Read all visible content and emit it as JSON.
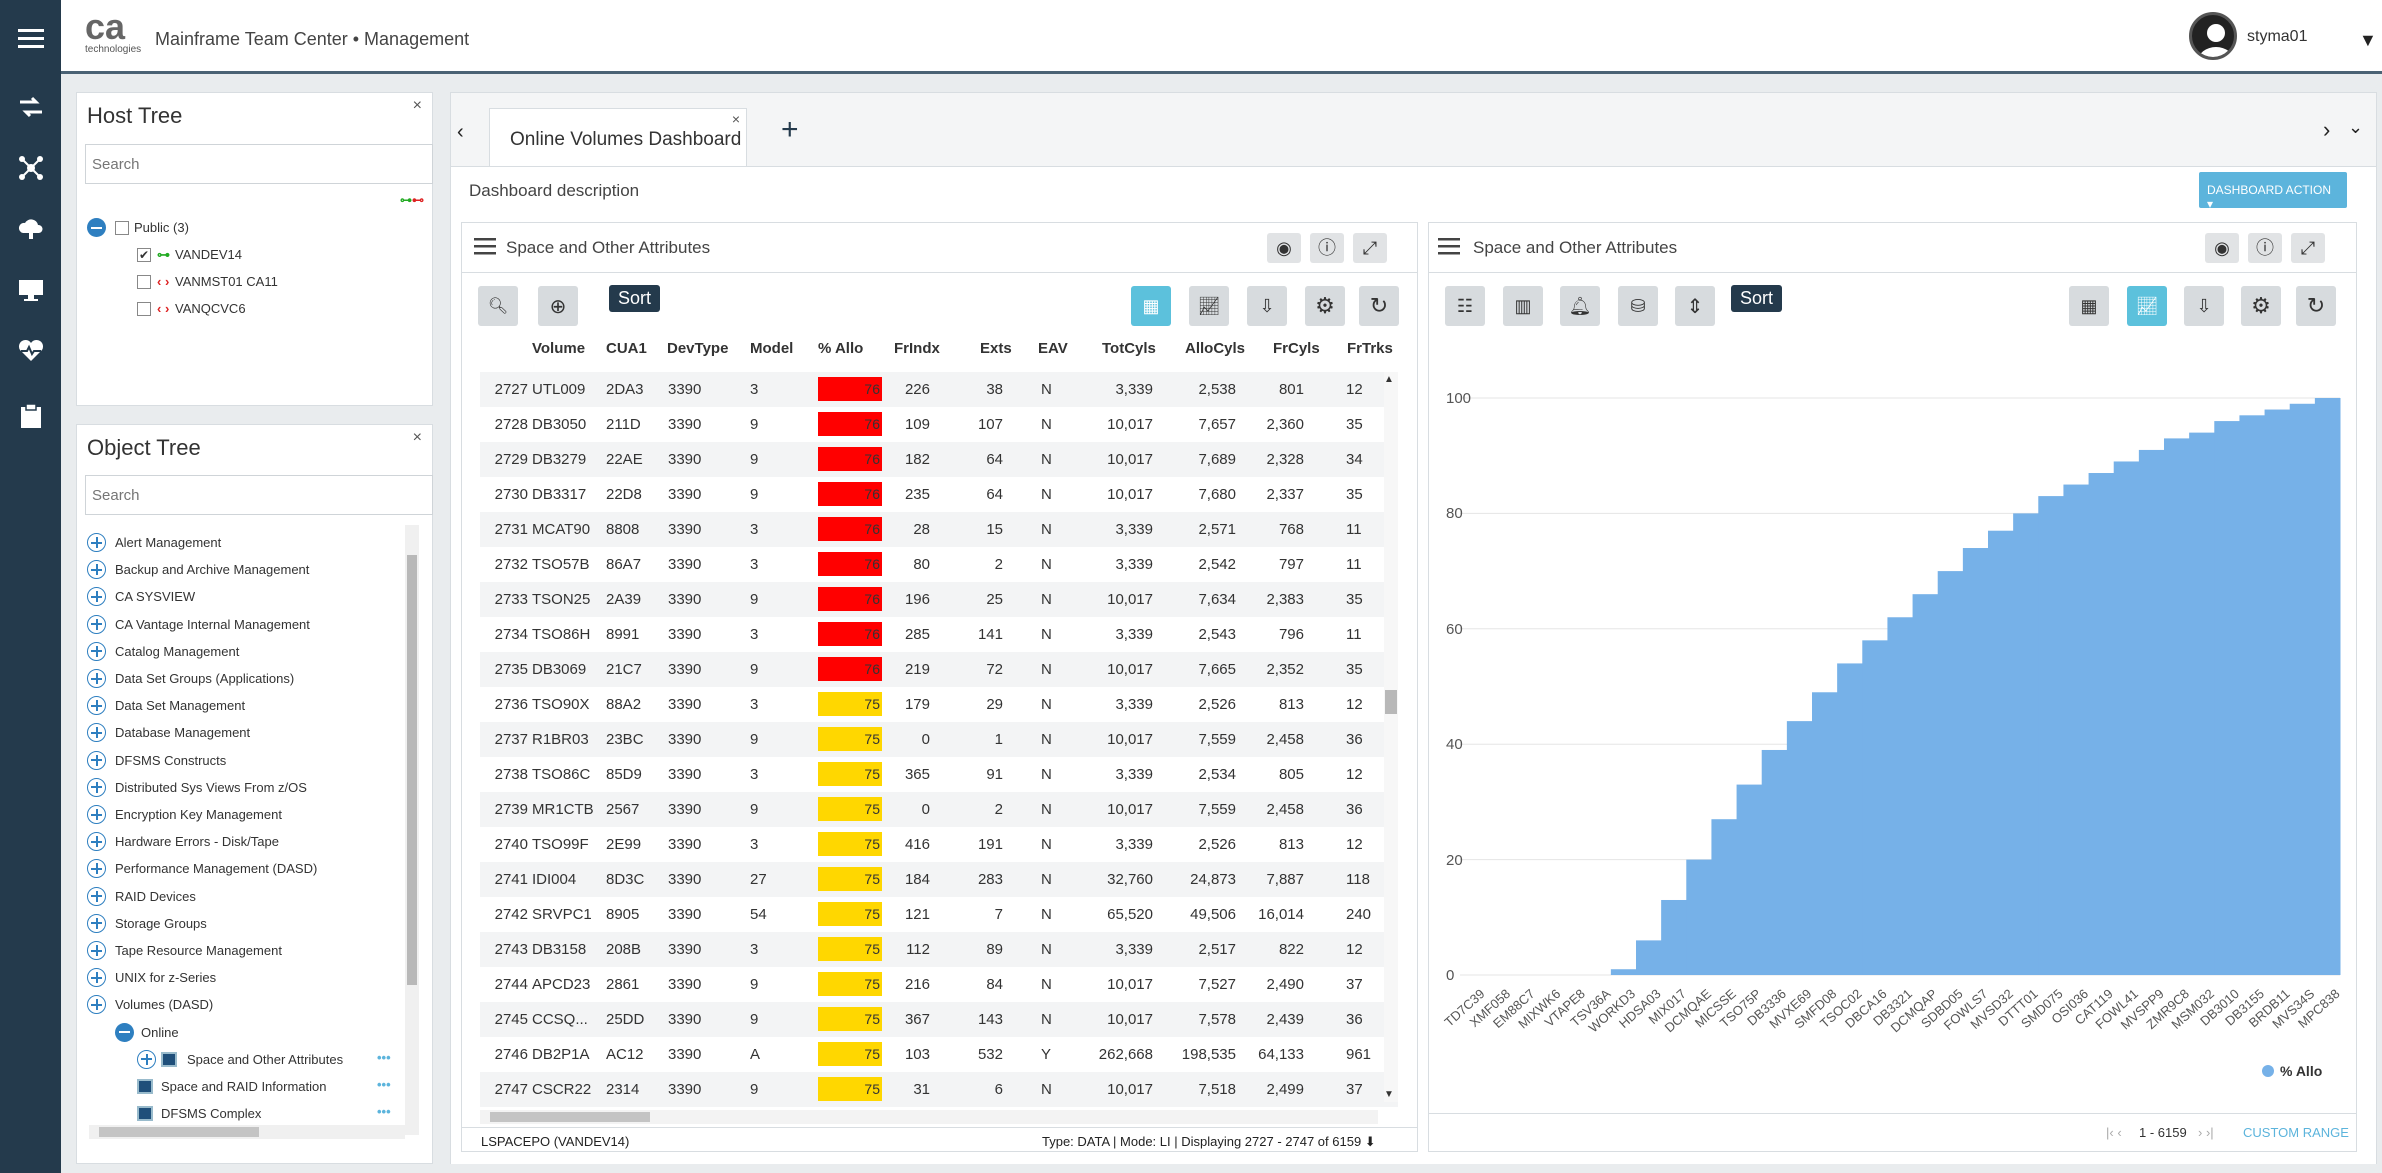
{
  "header": {
    "logo_text": "ca",
    "logo_sub": "technologies",
    "app_title": "Mainframe Team Center • Management",
    "username": "styma01"
  },
  "host_tree": {
    "title": "Host Tree",
    "search_placeholder": "Search",
    "close": "×",
    "root": "Public (3)",
    "items": [
      {
        "label": "VANDEV14",
        "checked": true,
        "status": "connected"
      },
      {
        "label": "VANMST01 CA11",
        "checked": false,
        "status": "disconnected"
      },
      {
        "label": "VANQCVC6",
        "checked": false,
        "status": "disconnected"
      }
    ]
  },
  "object_tree": {
    "title": "Object Tree",
    "search_placeholder": "Search",
    "close": "×",
    "items": [
      "Alert Management",
      "Backup and Archive Management",
      "CA SYSVIEW",
      "CA Vantage Internal Management",
      "Catalog Management",
      "Data Set Groups (Applications)",
      "Data Set Management",
      "Database Management",
      "DFSMS Constructs",
      "Distributed Sys Views From z/OS",
      "Encryption Key Management",
      "Hardware Errors - Disk/Tape",
      "Performance Management (DASD)",
      "RAID Devices",
      "Storage Groups",
      "Tape Resource Management",
      "UNIX for z-Series",
      "Volumes (DASD)"
    ],
    "online": "Online",
    "sub_items": [
      "Space and Other Attributes",
      "Space and RAID Information",
      "DFSMS Complex"
    ],
    "more": "•••"
  },
  "tabs": {
    "active": "Online Volumes Dashboard",
    "close": "×",
    "add": "+"
  },
  "dashboard": {
    "description": "Dashboard description",
    "action_button": "DASHBOARD ACTION ▾"
  },
  "grid_panel": {
    "title": "Space and Other Attributes",
    "sort": "Sort",
    "columns": [
      "Volume",
      "CUA1",
      "DevType",
      "Model",
      "% Allo",
      "FrIndx",
      "Exts",
      "EAV",
      "TotCyls",
      "AlloCyls",
      "FrCyls",
      "FrTrks"
    ],
    "rows": [
      [
        "2727",
        "UTL009",
        "2DA3",
        "3390",
        "3",
        "76",
        "226",
        "38",
        "N",
        "3,339",
        "2,538",
        "801",
        "12"
      ],
      [
        "2728",
        "DB3050",
        "211D",
        "3390",
        "9",
        "76",
        "109",
        "107",
        "N",
        "10,017",
        "7,657",
        "2,360",
        "35"
      ],
      [
        "2729",
        "DB3279",
        "22AE",
        "3390",
        "9",
        "76",
        "182",
        "64",
        "N",
        "10,017",
        "7,689",
        "2,328",
        "34"
      ],
      [
        "2730",
        "DB3317",
        "22D8",
        "3390",
        "9",
        "76",
        "235",
        "64",
        "N",
        "10,017",
        "7,680",
        "2,337",
        "35"
      ],
      [
        "2731",
        "MCAT90",
        "8808",
        "3390",
        "3",
        "76",
        "28",
        "15",
        "N",
        "3,339",
        "2,571",
        "768",
        "11"
      ],
      [
        "2732",
        "TSO57B",
        "86A7",
        "3390",
        "3",
        "76",
        "80",
        "2",
        "N",
        "3,339",
        "2,542",
        "797",
        "11"
      ],
      [
        "2733",
        "TSON25",
        "2A39",
        "3390",
        "9",
        "76",
        "196",
        "25",
        "N",
        "10,017",
        "7,634",
        "2,383",
        "35"
      ],
      [
        "2734",
        "TSO86H",
        "8991",
        "3390",
        "3",
        "76",
        "285",
        "141",
        "N",
        "3,339",
        "2,543",
        "796",
        "11"
      ],
      [
        "2735",
        "DB3069",
        "21C7",
        "3390",
        "9",
        "76",
        "219",
        "72",
        "N",
        "10,017",
        "7,665",
        "2,352",
        "35"
      ],
      [
        "2736",
        "TSO90X",
        "88A2",
        "3390",
        "3",
        "75",
        "179",
        "29",
        "N",
        "3,339",
        "2,526",
        "813",
        "12"
      ],
      [
        "2737",
        "R1BR03",
        "23BC",
        "3390",
        "9",
        "75",
        "0",
        "1",
        "N",
        "10,017",
        "7,559",
        "2,458",
        "36"
      ],
      [
        "2738",
        "TSO86C",
        "85D9",
        "3390",
        "3",
        "75",
        "365",
        "91",
        "N",
        "3,339",
        "2,534",
        "805",
        "12"
      ],
      [
        "2739",
        "MR1CTB",
        "2567",
        "3390",
        "9",
        "75",
        "0",
        "2",
        "N",
        "10,017",
        "7,559",
        "2,458",
        "36"
      ],
      [
        "2740",
        "TSO99F",
        "2E99",
        "3390",
        "3",
        "75",
        "416",
        "191",
        "N",
        "3,339",
        "2,526",
        "813",
        "12"
      ],
      [
        "2741",
        "IDI004",
        "8D3C",
        "3390",
        "27",
        "75",
        "184",
        "283",
        "N",
        "32,760",
        "24,873",
        "7,887",
        "118"
      ],
      [
        "2742",
        "SRVPC1",
        "8905",
        "3390",
        "54",
        "75",
        "121",
        "7",
        "N",
        "65,520",
        "49,506",
        "16,014",
        "240"
      ],
      [
        "2743",
        "DB3158",
        "208B",
        "3390",
        "3",
        "75",
        "112",
        "89",
        "N",
        "3,339",
        "2,517",
        "822",
        "12"
      ],
      [
        "2744",
        "APCD23",
        "2861",
        "3390",
        "9",
        "75",
        "216",
        "84",
        "N",
        "10,017",
        "7,527",
        "2,490",
        "37"
      ],
      [
        "2745",
        "CCSQ...",
        "25DD",
        "3390",
        "9",
        "75",
        "367",
        "143",
        "N",
        "10,017",
        "7,578",
        "2,439",
        "36"
      ],
      [
        "2746",
        "DB2P1A",
        "AC12",
        "3390",
        "A",
        "75",
        "103",
        "532",
        "Y",
        "262,668",
        "198,535",
        "64,133",
        "961"
      ],
      [
        "2747",
        "CSCR22",
        "2314",
        "3390",
        "9",
        "75",
        "31",
        "6",
        "N",
        "10,017",
        "7,518",
        "2,499",
        "37"
      ]
    ],
    "footer_left": "LSPACEPO (VANDEV14)",
    "footer_right": "Type: DATA | Mode: LI | Displaying 2727 - 2747 of 6159 ⬇",
    "colors": {
      "red": "#ff0000",
      "yellow": "#ffd700"
    }
  },
  "chart_panel": {
    "title": "Space and Other Attributes",
    "sort": "Sort",
    "pager": "1 - 6159",
    "custom_range": "CUSTOM RANGE"
  },
  "chart_data": {
    "type": "bar",
    "series": [
      {
        "name": "% Allo",
        "color": "#76b1e8"
      }
    ],
    "ylim": [
      0,
      100
    ],
    "yticks": [
      0,
      20,
      40,
      60,
      80,
      100
    ],
    "categories": [
      "TD7C39",
      "XMF058",
      "EM88C7",
      "MIXWK6",
      "VTAPE8",
      "TSV36A",
      "WORKD3",
      "HDSA03",
      "MIX017",
      "DCMQAE",
      "MICSSE",
      "TSO75P",
      "DB3336",
      "MVXE69",
      "SMFD08",
      "TSOC02",
      "DBCA16",
      "DB3321",
      "DCMQAP",
      "SDBD05",
      "FOWLS7",
      "MVSD32",
      "DTTT01",
      "SMD075",
      "OSI036",
      "CAT119",
      "FOWL41",
      "MVSPP9",
      "ZMR9C8",
      "MSM032",
      "DB3010",
      "DB3155",
      "BRDB11",
      "MVS34S",
      "MPC838"
    ],
    "values": [
      0,
      0,
      0,
      0,
      0,
      0,
      1,
      6,
      13,
      20,
      27,
      33,
      39,
      44,
      49,
      54,
      58,
      62,
      66,
      70,
      74,
      77,
      80,
      83,
      85,
      87,
      89,
      91,
      93,
      94,
      96,
      97,
      98,
      99,
      100
    ]
  }
}
